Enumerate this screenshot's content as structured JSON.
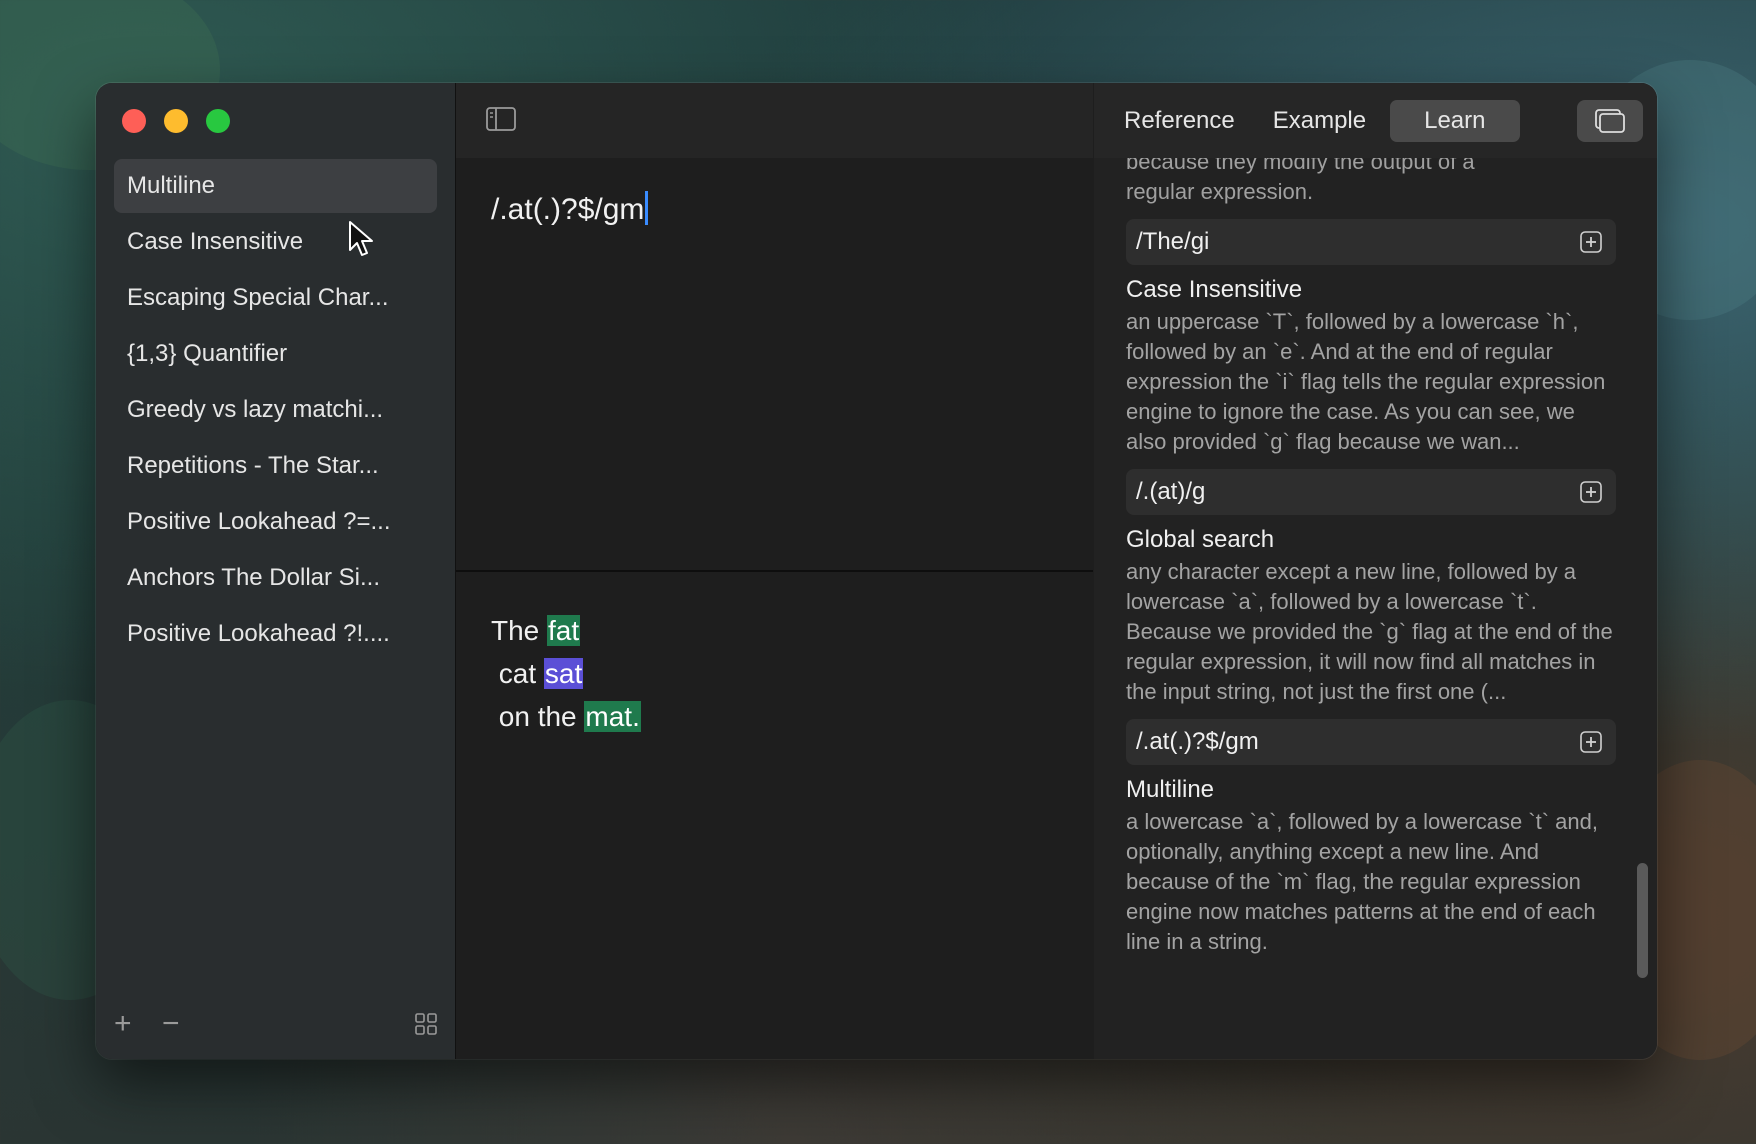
{
  "sidebar": {
    "items": [
      {
        "label": "Multiline",
        "selected": true
      },
      {
        "label": "Case Insensitive",
        "selected": false
      },
      {
        "label": "Escaping Special Char...",
        "selected": false
      },
      {
        "label": "{1,3} Quantifier",
        "selected": false
      },
      {
        "label": "Greedy vs lazy matchi...",
        "selected": false
      },
      {
        "label": "Repetitions - The Star...",
        "selected": false
      },
      {
        "label": "Positive Lookahead ?=...",
        "selected": false
      },
      {
        "label": "Anchors The Dollar Si...",
        "selected": false
      },
      {
        "label": "Positive Lookahead ?!....",
        "selected": false
      }
    ],
    "footer": {
      "add_label": "+",
      "remove_label": "−",
      "grid_icon": "grid-icon"
    }
  },
  "editor": {
    "regex": "/.at(.)?$/gm",
    "test_text": {
      "line1": {
        "plain": "The ",
        "match": "fat"
      },
      "line2": {
        "plain": " cat ",
        "match": "sat"
      },
      "line3": {
        "plain": " on the ",
        "match": "mat."
      }
    }
  },
  "reference": {
    "tabs": {
      "reference": "Reference",
      "example": "Example",
      "learn": "Learn",
      "active": "Learn"
    },
    "intro_line1": "because they modify the output of a",
    "intro_line2": "regular expression.",
    "examples": [
      {
        "pattern": "/The/gi",
        "title": "Case Insensitive",
        "description": "an uppercase `T`, followed by a lowercase `h`, followed by an `e`. And at the end of regular expression the `i` flag tells the regular expression engine to ignore the case. As you can see, we also provided `g` flag because we wan..."
      },
      {
        "pattern": "/.(at)/g",
        "title": "Global search",
        "description": "any character except a new line, followed by a lowercase `a`, followed by a lowercase `t`. Because we provided the `g` flag at the end of the regular expression, it will now find all matches in the input string, not just the first one (..."
      },
      {
        "pattern": "/.at(.)?$/gm",
        "title": "Multiline",
        "description": "a lowercase `a`, followed by a lowercase `t` and, optionally, anything except a new line. And because of the `m` flag, the regular expression engine now matches patterns at the end of each line in a string."
      }
    ]
  },
  "colors": {
    "match_green": "#1f7a4d",
    "match_purple": "#5b4fd6",
    "caret_blue": "#3a8cff"
  }
}
